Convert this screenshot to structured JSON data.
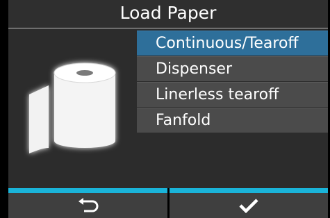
{
  "header": {
    "title": "Load Paper"
  },
  "menu": {
    "items": [
      {
        "label": "Continuous/Tearoff",
        "selected": true
      },
      {
        "label": "Dispenser",
        "selected": false
      },
      {
        "label": "Linerless tearoff",
        "selected": false
      },
      {
        "label": "Fanfold",
        "selected": false
      }
    ]
  },
  "illustration": {
    "icon": "paper-roll-icon"
  },
  "footer": {
    "back_icon": "return-arrow-icon",
    "confirm_icon": "checkmark-icon",
    "accent_color": "#1ab4d9"
  },
  "colors": {
    "selected_item": "#2e6f9a",
    "item_background": "#4b4b4b",
    "panel_background": "#2c2c2c"
  }
}
